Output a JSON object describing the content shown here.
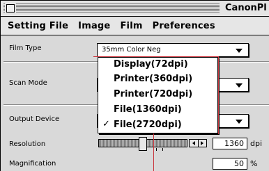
{
  "window": {
    "title": "CanonPl"
  },
  "menubar": {
    "items": [
      "Setting File",
      "Image",
      "Film",
      "Preferences"
    ]
  },
  "settings": {
    "film_type": {
      "label": "Film Type",
      "value": "35mm Color Neg"
    },
    "scan_mode": {
      "label": "Scan Mode"
    },
    "output_device": {
      "label": "Output Device"
    },
    "resolution": {
      "label": "Resolution",
      "value": "1360",
      "unit": "dpi",
      "slider_fraction": 0.5
    },
    "magnification": {
      "label": "Magnification",
      "value": "50",
      "unit": "%"
    }
  },
  "output_device_menu": {
    "options": [
      {
        "label": "Display(72dpi)",
        "checked": false
      },
      {
        "label": "Printer(360dpi)",
        "checked": false
      },
      {
        "label": "Printer(720dpi)",
        "checked": false
      },
      {
        "label": "File(1360dpi)",
        "checked": false
      },
      {
        "label": "File(2720dpi)",
        "checked": true
      }
    ],
    "checkmark": "✓"
  },
  "colors": {
    "window_bg": "#d9d9d9",
    "menu_bg": "#ffffff",
    "guide": "#c9323a"
  }
}
